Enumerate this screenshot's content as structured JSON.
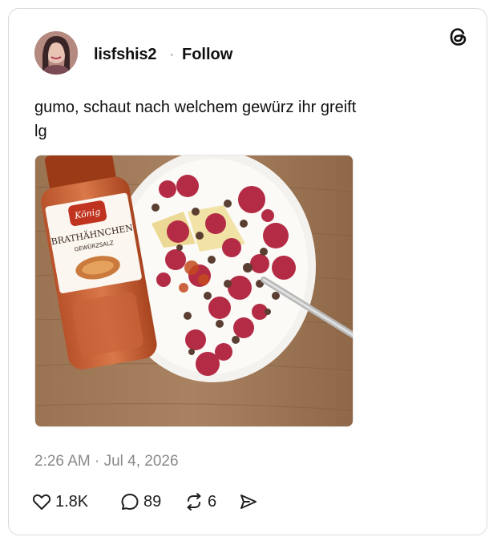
{
  "post": {
    "username": "lisfshis2",
    "separator": "·",
    "follow_label": "Follow",
    "text": "gumo, schaut nach welchem gewürz ihr greift\nlg",
    "timestamp": "2:26 AM · Jul 4, 2026",
    "photo": {
      "bottle_brand": "König",
      "bottle_label_line1": "BRATHÄHNCHEN",
      "bottle_label_line2": "GEWÜRZSALZ"
    }
  },
  "actions": {
    "likes": "1.8K",
    "replies": "89",
    "reposts": "6"
  },
  "icons": {
    "like": "heart-icon",
    "reply": "comment-icon",
    "repost": "repost-icon",
    "share": "share-icon",
    "logo": "threads-logo-icon"
  }
}
